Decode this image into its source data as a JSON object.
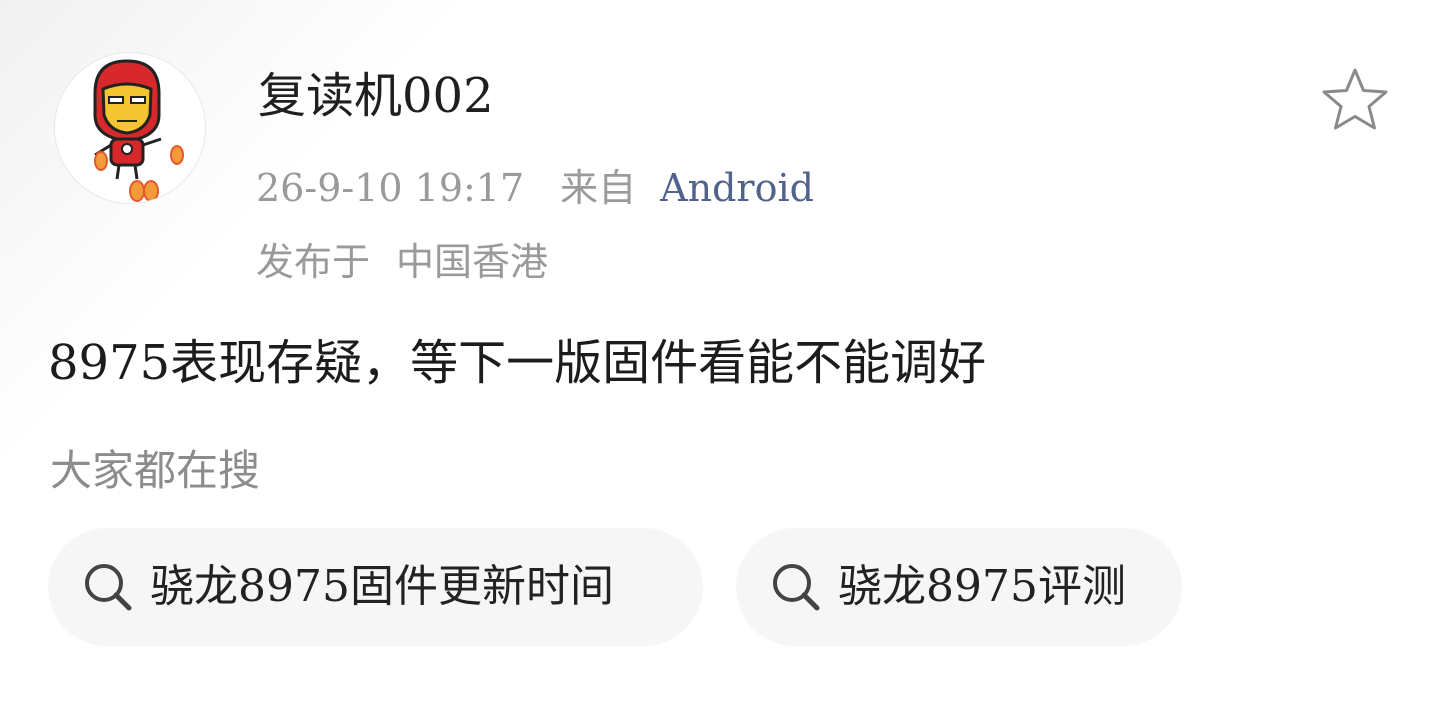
{
  "post": {
    "avatar": {
      "icon": "iron-man-avatar-icon"
    },
    "username": "复读机002",
    "timestamp": "26-9-10  19:17",
    "from_label": "来自",
    "source": "Android",
    "location_label": "发布于",
    "location": "中国香港",
    "text": "8975表现存疑，等下一版固件看能不能调好",
    "favorite_icon": "star-outline-icon"
  },
  "search": {
    "heading": "大家都在搜",
    "chips": [
      {
        "label": "骁龙8975固件更新时间",
        "icon": "search-icon"
      },
      {
        "label": "骁龙8975评测",
        "icon": "search-icon"
      }
    ]
  },
  "colors": {
    "source_link": "#51628c",
    "meta_text": "#9a9a9a",
    "chip_background": "#f6f6f6",
    "avatar_red": "#d7282b",
    "avatar_gold": "#f5c431"
  }
}
